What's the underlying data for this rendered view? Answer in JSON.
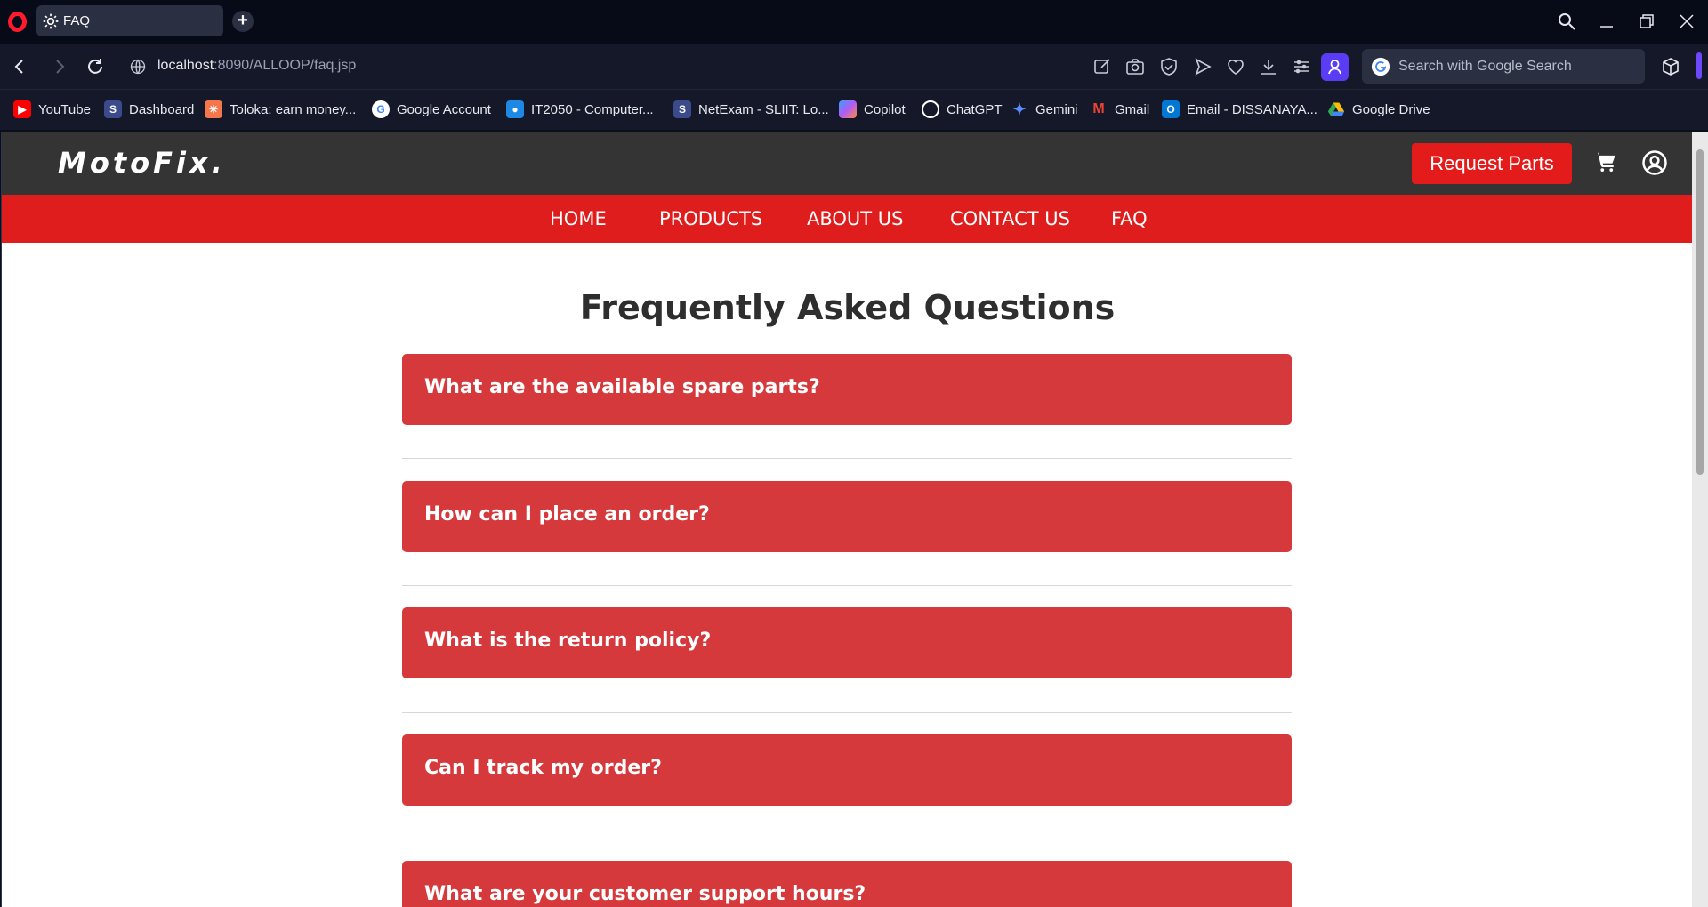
{
  "browser": {
    "tab": {
      "title": "FAQ"
    },
    "url": {
      "host": "localhost",
      "path": ":8090/ALLOOP/faq.jsp"
    },
    "search": {
      "placeholder": "Search with Google Search"
    },
    "bookmarks": [
      {
        "label": "YouTube",
        "icon": "youtube-icon",
        "color": "#ff0000"
      },
      {
        "label": "Dashboard",
        "icon": "sliit-icon",
        "color": "#3b4a8a"
      },
      {
        "label": "Toloka: earn money...",
        "icon": "toloka-icon",
        "color": "#f4774b"
      },
      {
        "label": "Google Account",
        "icon": "google-icon",
        "color": "#ffffff"
      },
      {
        "label": "IT2050 - Computer...",
        "icon": "classroom-icon",
        "color": "#1e88e5"
      },
      {
        "label": "NetExam - SLIIT: Lo...",
        "icon": "sliit-icon",
        "color": "#3b4a8a"
      },
      {
        "label": "Copilot",
        "icon": "copilot-icon",
        "color": "#8a5cf6"
      },
      {
        "label": "ChatGPT",
        "icon": "chatgpt-icon",
        "color": "#ffffff"
      },
      {
        "label": "Gemini",
        "icon": "gemini-icon",
        "color": "#5b8cff"
      },
      {
        "label": "Gmail",
        "icon": "gmail-icon",
        "color": "#ea4335"
      },
      {
        "label": "Email - DISSANAYA...",
        "icon": "outlook-icon",
        "color": "#0078d4"
      },
      {
        "label": "Google Drive",
        "icon": "drive-icon",
        "color": "#34a853"
      }
    ]
  },
  "site": {
    "logo": "MotoFix.",
    "request_button": "Request Parts",
    "nav": [
      "HOME",
      "PRODUCTS",
      "ABOUT US",
      "CONTACT US",
      "FAQ"
    ],
    "faq_title": "Frequently Asked Questions",
    "faqs": [
      "What are the available spare parts?",
      "How can I place an order?",
      "What is the return policy?",
      "Can I track my order?",
      "What are your customer support hours?"
    ]
  },
  "colors": {
    "header_bg": "#343434",
    "nav_bg": "#e01d1d",
    "accordion_bg": "#d5393b",
    "request_btn": "#e31b1b"
  }
}
